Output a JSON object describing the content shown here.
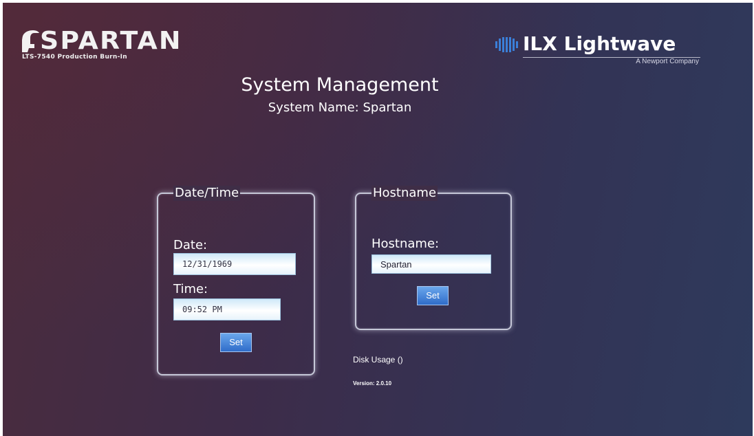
{
  "branding": {
    "product_logo_text": "SPARTAN",
    "product_logo_subtitle": "LTS-7540 Production Burn-In",
    "company_logo_text": "ILX Lightwave",
    "company_logo_subtitle": "A Newport Company"
  },
  "header": {
    "title": "System Management",
    "system_name_line": "System Name: Spartan"
  },
  "datetime_panel": {
    "legend": "Date/Time",
    "date_label": "Date:",
    "date_value": "12/31/1969",
    "time_label": "Time:",
    "time_value": "09:52 PM",
    "set_label": "Set"
  },
  "hostname_panel": {
    "legend": "Hostname",
    "hostname_label": "Hostname:",
    "hostname_value": "Spartan",
    "set_label": "Set"
  },
  "footer": {
    "disk_usage": "Disk Usage ()",
    "version": "Version: 2.0.10"
  },
  "colors": {
    "background_left": "#4b2c3d",
    "background_right": "#2e3a5c",
    "button_blue": "#3f7fd6",
    "field_light_blue": "#cfe8f8"
  },
  "icons": {
    "helmet": "spartan-helmet-icon",
    "ilx_bars": "ilx-bars-icon"
  }
}
